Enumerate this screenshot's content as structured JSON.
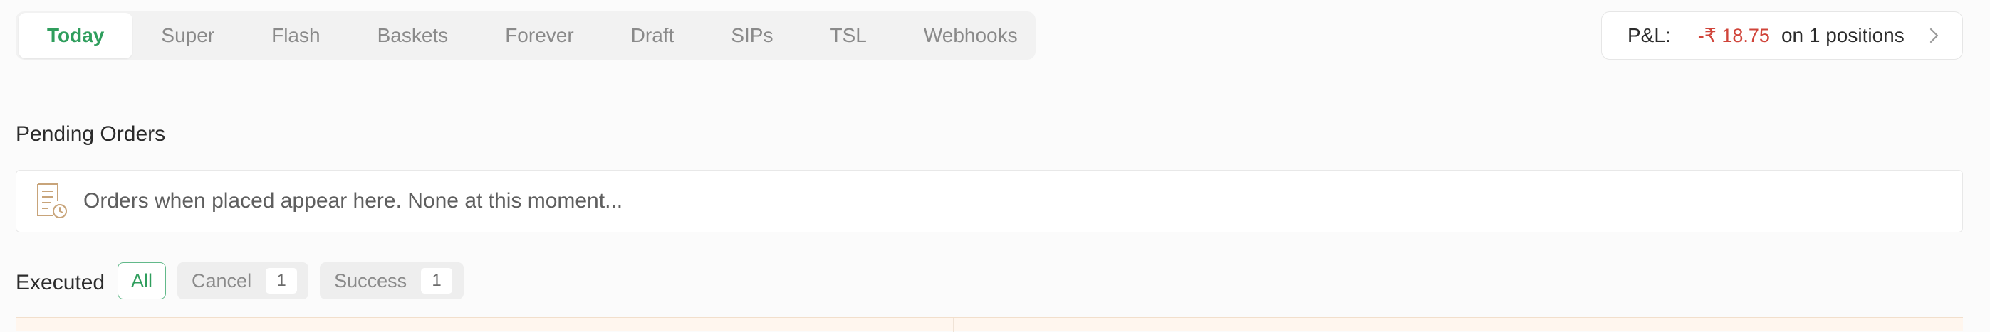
{
  "tabs": [
    {
      "label": "Today",
      "active": true
    },
    {
      "label": "Super",
      "active": false
    },
    {
      "label": "Flash",
      "active": false
    },
    {
      "label": "Baskets",
      "active": false
    },
    {
      "label": "Forever",
      "active": false
    },
    {
      "label": "Draft",
      "active": false
    },
    {
      "label": "SIPs",
      "active": false
    },
    {
      "label": "TSL",
      "active": false
    },
    {
      "label": "Webhooks",
      "active": false
    }
  ],
  "pnl": {
    "label": "P&L:",
    "value": "-₹ 18.75",
    "suffix": "on 1 positions",
    "icon": "chevron-right-icon"
  },
  "pending": {
    "title": "Pending Orders",
    "empty_message": "Orders when placed appear here. None at this moment...",
    "icon": "order-receipt-clock-icon"
  },
  "executed": {
    "title": "Executed",
    "filters": [
      {
        "label": "All",
        "count": null,
        "selected": true
      },
      {
        "label": "Cancel",
        "count": "1",
        "selected": false
      },
      {
        "label": "Success",
        "count": "1",
        "selected": false
      }
    ]
  },
  "colors": {
    "accent_green": "#2f9e5d",
    "loss_red": "#d0443a",
    "table_header_bg": "#fff6ee"
  }
}
